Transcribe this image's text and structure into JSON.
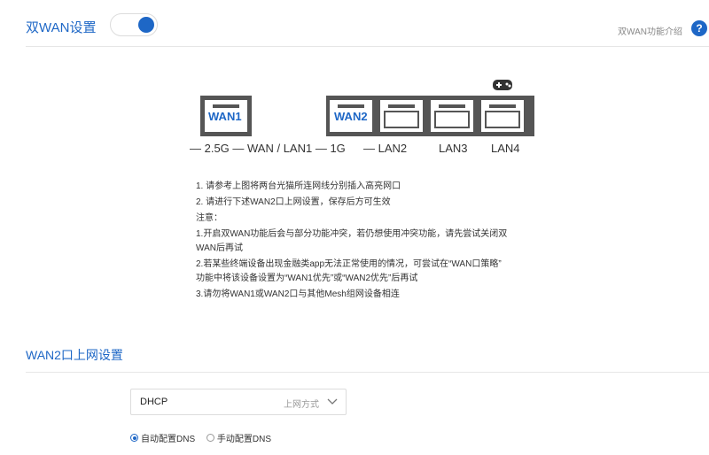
{
  "header": {
    "title": "双WAN设置",
    "toggle_on": true,
    "help_text": "双WAN功能介绍",
    "help_icon": "?"
  },
  "diagram": {
    "wan1_tag": "WAN1",
    "wan2_tag": "WAN2",
    "labels": [
      "— 2.5G — WAN / LAN1 — 1G",
      "— LAN2",
      "LAN3",
      "LAN4"
    ],
    "gamepad_icon": "gamepad-icon"
  },
  "notes": {
    "line1": "1. 请参考上图将两台光猫所连网线分别插入高亮网口",
    "line2": "2. 请进行下述WAN2口上网设置，保存后方可生效",
    "line3": "注意：",
    "line4a": "1.开启双WAN功能后会与部分功能冲突，若仍想使用冲突功能，请先尝试关闭双",
    "line4b": "WAN后再试",
    "line5a": "2.若某些终端设备出现金融类app无法正常使用的情况，可尝试在“WAN口策略”",
    "line5b": "功能中将该设备设置为“WAN1优先”或“WAN2优先”后再试",
    "line6": "3.请勿将WAN1或WAN2口与其他Mesh组网设备相连"
  },
  "wan2": {
    "title": "WAN2口上网设置",
    "mode_value": "DHCP",
    "mode_hint": "上网方式",
    "dns_auto": "自动配置DNS",
    "dns_manual": "手动配置DNS",
    "dns_selected": "auto"
  },
  "colors": {
    "accent": "#1e67c6"
  }
}
